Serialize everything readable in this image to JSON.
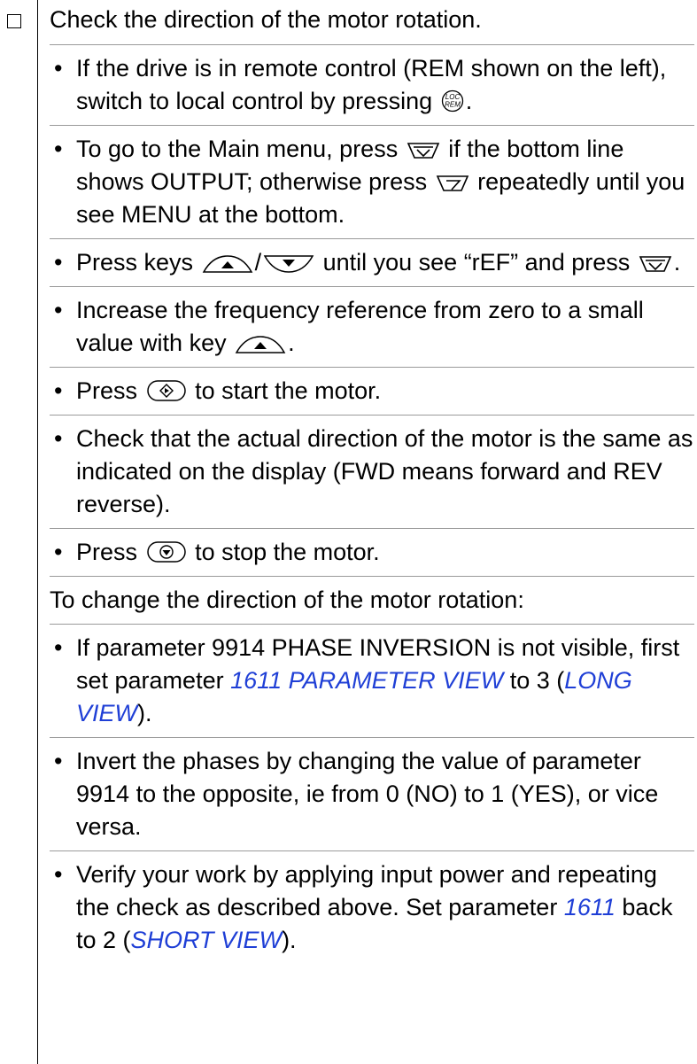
{
  "heading": "Check the direction of the motor rotation.",
  "steps": [
    {
      "t1": "If the drive is in remote control (REM shown on the left), switch to local control by pressing",
      "t2": "."
    },
    {
      "t1": "To go to the Main menu, press",
      "t2": "if the bottom line shows OUTPUT; otherwise press",
      "t3": "repeatedly until you see MENU at the bottom."
    },
    {
      "t1": "Press keys",
      "t2": "/",
      "t3": "until you see “rEF” and press",
      "t4": "."
    },
    {
      "t1": "Increase the frequency reference from zero to a small value with key",
      "t2": "."
    },
    {
      "t1": "Press",
      "t2": "to start the motor."
    },
    {
      "t1": "Check that the actual direction of the motor is the same as indicated on the display (FWD means forward and REV reverse)."
    },
    {
      "t1": "Press",
      "t2": "to stop the motor."
    }
  ],
  "change_heading": "To change the direction of the motor rotation:",
  "change_steps": [
    {
      "t1": "If parameter 9914 PHASE INVERSION is not visible, first set parameter",
      "link1": "1611 PARAMETER VIEW",
      "t2": "to 3 (",
      "link2": "LONG VIEW",
      "t3": ")."
    },
    {
      "t1": "Invert the phases by changing the value of parameter 9914 to the opposite, ie from 0 (NO) to 1 (YES), or vice versa."
    },
    {
      "t1": "Verify your work by applying input power and repeating the check as described above. Set parameter",
      "link1": "1611",
      "t2": "back to 2 (",
      "link2": "SHORT VIEW",
      "t3": ")."
    }
  ],
  "icons": {
    "loc_rem_key": "loc-rem-key-icon",
    "menu_key": "menu-enter-key-icon",
    "exit_key": "exit-key-icon",
    "up_key": "up-arrow-key-icon",
    "down_key": "down-arrow-key-icon",
    "start_key": "start-key-icon",
    "stop_key": "stop-key-icon"
  },
  "colors": {
    "link": "#1f3fd6"
  }
}
